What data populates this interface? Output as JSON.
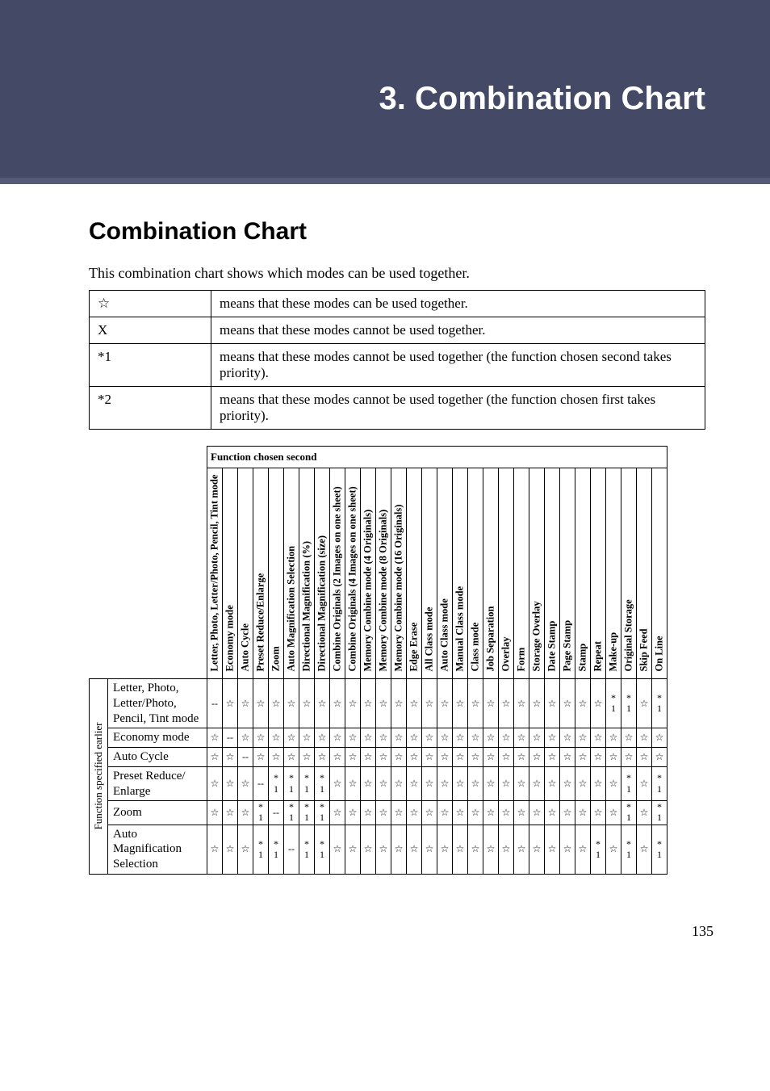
{
  "chapter_title": "3. Combination Chart",
  "section_title": "Combination Chart",
  "intro": "This combination chart shows which modes can be used together.",
  "legend": [
    {
      "sym": "☆",
      "desc": "means that these modes can be used together."
    },
    {
      "sym": "X",
      "desc": "means that these modes cannot be used together."
    },
    {
      "sym": "*1",
      "desc": "means that these modes cannot be used together (the function chosen second takes priority)."
    },
    {
      "sym": "*2",
      "desc": "means that these modes cannot be used together (the function chosen first takes priority)."
    }
  ],
  "top_header": "Function chosen second",
  "side_label": "Function specified earlier",
  "columns": [
    "Letter, Photo, Letter/Photo, Pencil, Tint mode",
    "Economy mode",
    "Auto Cycle",
    "Preset Reduce/Enlarge",
    "Zoom",
    "Auto Magnification Selection",
    "Directional Magnification (%)",
    "Directional Magnification (size)",
    "Combine Originals (2 Images on one sheet)",
    "Combine Originals (4 Images on one sheet)",
    "Memory Combine mode (4 Originals)",
    "Memory Combine mode (8 Originals)",
    "Memory Combine mode (16 Originals)",
    "Edge Erase",
    "All Class mode",
    "Auto Class mode",
    "Manual Class mode",
    "Class mode",
    "Job Separation",
    "Overlay",
    "Form",
    "Storage Overlay",
    "Date Stamp",
    "Page Stamp",
    "Stamp",
    "Repeat",
    "Make-up",
    "Original Storage",
    "Skip Feed",
    "On Line"
  ],
  "rows": [
    {
      "label": "Letter, Photo, Letter/Photo, Pencil, Tint mode",
      "cells": [
        "--",
        "☆",
        "☆",
        "☆",
        "☆",
        "☆",
        "☆",
        "☆",
        "☆",
        "☆",
        "☆",
        "☆",
        "☆",
        "☆",
        "☆",
        "☆",
        "☆",
        "☆",
        "☆",
        "☆",
        "☆",
        "☆",
        "☆",
        "☆",
        "☆",
        "☆",
        "*1",
        "*1",
        "☆",
        "*1"
      ]
    },
    {
      "label": "Economy mode",
      "cells": [
        "☆",
        "--",
        "☆",
        "☆",
        "☆",
        "☆",
        "☆",
        "☆",
        "☆",
        "☆",
        "☆",
        "☆",
        "☆",
        "☆",
        "☆",
        "☆",
        "☆",
        "☆",
        "☆",
        "☆",
        "☆",
        "☆",
        "☆",
        "☆",
        "☆",
        "☆",
        "☆",
        "☆",
        "☆",
        "☆"
      ]
    },
    {
      "label": "Auto Cycle",
      "cells": [
        "☆",
        "☆",
        "--",
        "☆",
        "☆",
        "☆",
        "☆",
        "☆",
        "☆",
        "☆",
        "☆",
        "☆",
        "☆",
        "☆",
        "☆",
        "☆",
        "☆",
        "☆",
        "☆",
        "☆",
        "☆",
        "☆",
        "☆",
        "☆",
        "☆",
        "☆",
        "☆",
        "☆",
        "☆",
        "☆"
      ]
    },
    {
      "label": "Preset Reduce/Enlarge",
      "cells": [
        "☆",
        "☆",
        "☆",
        "--",
        "*1",
        "*1",
        "*1",
        "*1",
        "☆",
        "☆",
        "☆",
        "☆",
        "☆",
        "☆",
        "☆",
        "☆",
        "☆",
        "☆",
        "☆",
        "☆",
        "☆",
        "☆",
        "☆",
        "☆",
        "☆",
        "☆",
        "☆",
        "*1",
        "☆",
        "*1"
      ]
    },
    {
      "label": "Zoom",
      "cells": [
        "☆",
        "☆",
        "☆",
        "*1",
        "--",
        "*1",
        "*1",
        "*1",
        "☆",
        "☆",
        "☆",
        "☆",
        "☆",
        "☆",
        "☆",
        "☆",
        "☆",
        "☆",
        "☆",
        "☆",
        "☆",
        "☆",
        "☆",
        "☆",
        "☆",
        "☆",
        "☆",
        "*1",
        "☆",
        "*1"
      ]
    },
    {
      "label": "Auto Magnification Selection",
      "cells": [
        "☆",
        "☆",
        "☆",
        "*1",
        "*1",
        "--",
        "*1",
        "*1",
        "☆",
        "☆",
        "☆",
        "☆",
        "☆",
        "☆",
        "☆",
        "☆",
        "☆",
        "☆",
        "☆",
        "☆",
        "☆",
        "☆",
        "☆",
        "☆",
        "☆",
        "*1",
        "☆",
        "*1",
        "☆",
        "*1"
      ]
    }
  ],
  "page_number": "135"
}
